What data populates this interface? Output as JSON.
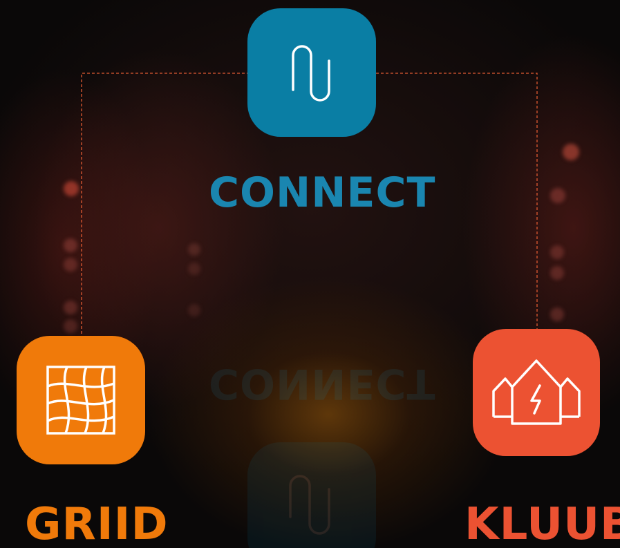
{
  "nodes": {
    "connect": {
      "label": "CONNECT",
      "icon": "paperclip-icon",
      "color": "#0a7ea4",
      "label_color": "#1a86b0"
    },
    "griid": {
      "label": "GRIID",
      "icon": "grid-mesh-icon",
      "color": "#f07a0a",
      "label_color": "#f07a0a"
    },
    "kluub": {
      "label": "KLUUB",
      "icon": "houses-energy-icon",
      "color": "#ec5232",
      "label_color": "#ec5232"
    }
  },
  "connector_color": "#e05a32"
}
